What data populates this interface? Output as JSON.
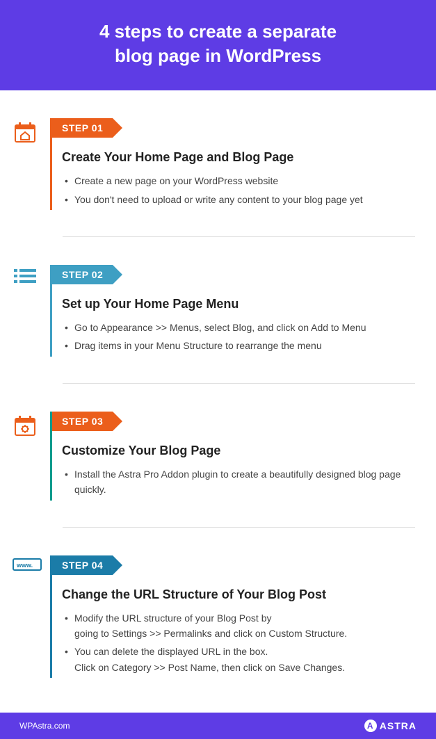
{
  "header": {
    "title_line1": "4 steps to create a separate",
    "title_line2": "blog page in WordPress"
  },
  "steps": [
    {
      "badge": "STEP 01",
      "title": "Create Your Home Page and Blog Page",
      "bullets": [
        "Create a new page on your WordPress website",
        "You don't need to upload or write any content to your blog page yet"
      ]
    },
    {
      "badge": "STEP 02",
      "title": "Set up Your Home Page Menu",
      "bullets": [
        "Go to Appearance >> Menus, select Blog, and click on Add to Menu",
        "Drag items in your Menu Structure to rearrange the menu"
      ]
    },
    {
      "badge": "STEP 03",
      "title": "Customize Your Blog Page",
      "bullets": [
        "Install the Astra Pro Addon plugin to create a beautifully designed blog page quickly."
      ]
    },
    {
      "badge": "STEP 04",
      "title": "Change the URL Structure of Your Blog Post",
      "bullets_complex": [
        {
          "main": "Modify the URL structure of your Blog Post by",
          "sub": "going to Settings >> Permalinks and click on Custom Structure."
        },
        {
          "main": "You can delete the displayed URL in the box.",
          "sub": "Click on Category >> Post Name, then click on Save Changes."
        }
      ]
    }
  ],
  "footer": {
    "site": "WPAstra.com",
    "brand": "ASTRA"
  }
}
